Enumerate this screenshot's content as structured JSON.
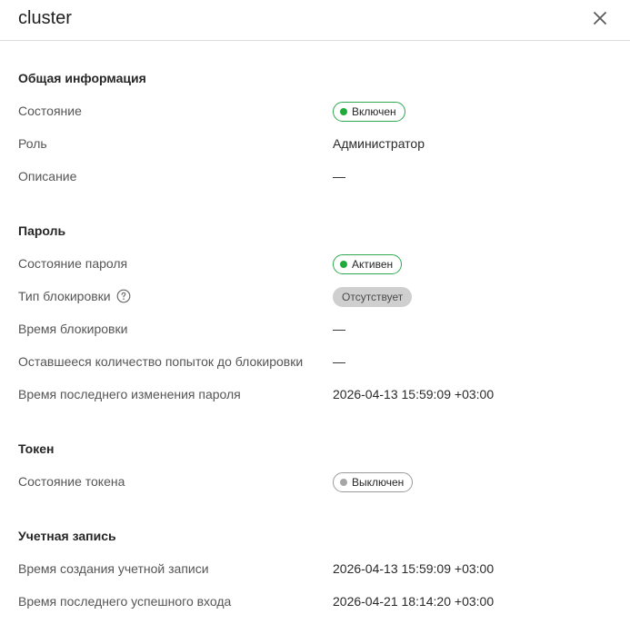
{
  "header": {
    "title": "cluster"
  },
  "sections": {
    "general": {
      "title": "Общая информация",
      "state_label": "Состояние",
      "state_value": "Включен",
      "role_label": "Роль",
      "role_value": "Администратор",
      "description_label": "Описание",
      "description_value": "—"
    },
    "password": {
      "title": "Пароль",
      "state_label": "Состояние пароля",
      "state_value": "Активен",
      "lock_type_label": "Тип блокировки",
      "lock_type_value": "Отсутствует",
      "lock_time_label": "Время блокировки",
      "lock_time_value": "—",
      "attempts_label": "Оставшееся количество попыток до блокировки",
      "attempts_value": "—",
      "last_change_label": "Время последнего изменения пароля",
      "last_change_value": "2026-04-13 15:59:09 +03:00"
    },
    "token": {
      "title": "Токен",
      "state_label": "Состояние токена",
      "state_value": "Выключен"
    },
    "account": {
      "title": "Учетная запись",
      "created_label": "Время создания учетной записи",
      "created_value": "2026-04-13 15:59:09 +03:00",
      "last_login_label": "Время последнего успешного входа",
      "last_login_value": "2026-04-21 18:14:20 +03:00"
    }
  },
  "icons": {
    "close": "close-icon",
    "help": "question-circle-icon",
    "status_dot": "status-dot-icon"
  },
  "colors": {
    "enabled": "#1faa3c",
    "disabled": "#a6a6a6",
    "badge_border_green": "#2fa84f",
    "badge_fill_gray": "#cfcfcf"
  }
}
